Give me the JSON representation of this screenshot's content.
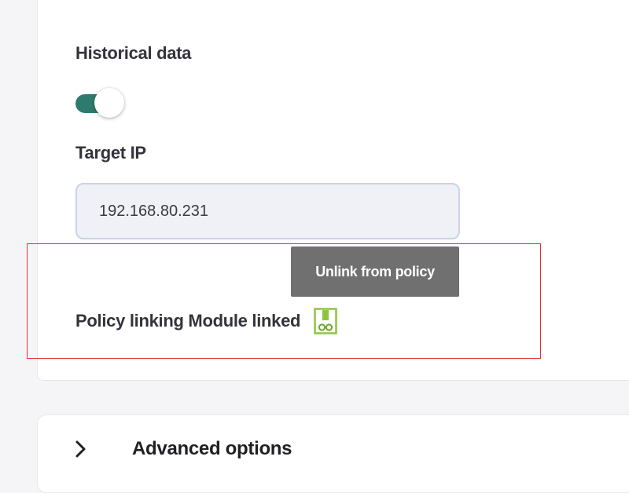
{
  "historical": {
    "label": "Historical data",
    "enabled": true
  },
  "target": {
    "label": "Target IP",
    "value": "192.168.80.231"
  },
  "tooltip": {
    "text": "Unlink from policy"
  },
  "policy": {
    "text": "Policy linking Module linked",
    "icon": "unlink-policy-icon"
  },
  "advanced": {
    "label": "Advanced options",
    "icon": "chevron-right-icon"
  },
  "colors": {
    "toggle_on": "#2f7a6e",
    "highlight_border": "#e0303a",
    "tooltip_bg": "#707070",
    "link_icon": "#8cc63e"
  }
}
